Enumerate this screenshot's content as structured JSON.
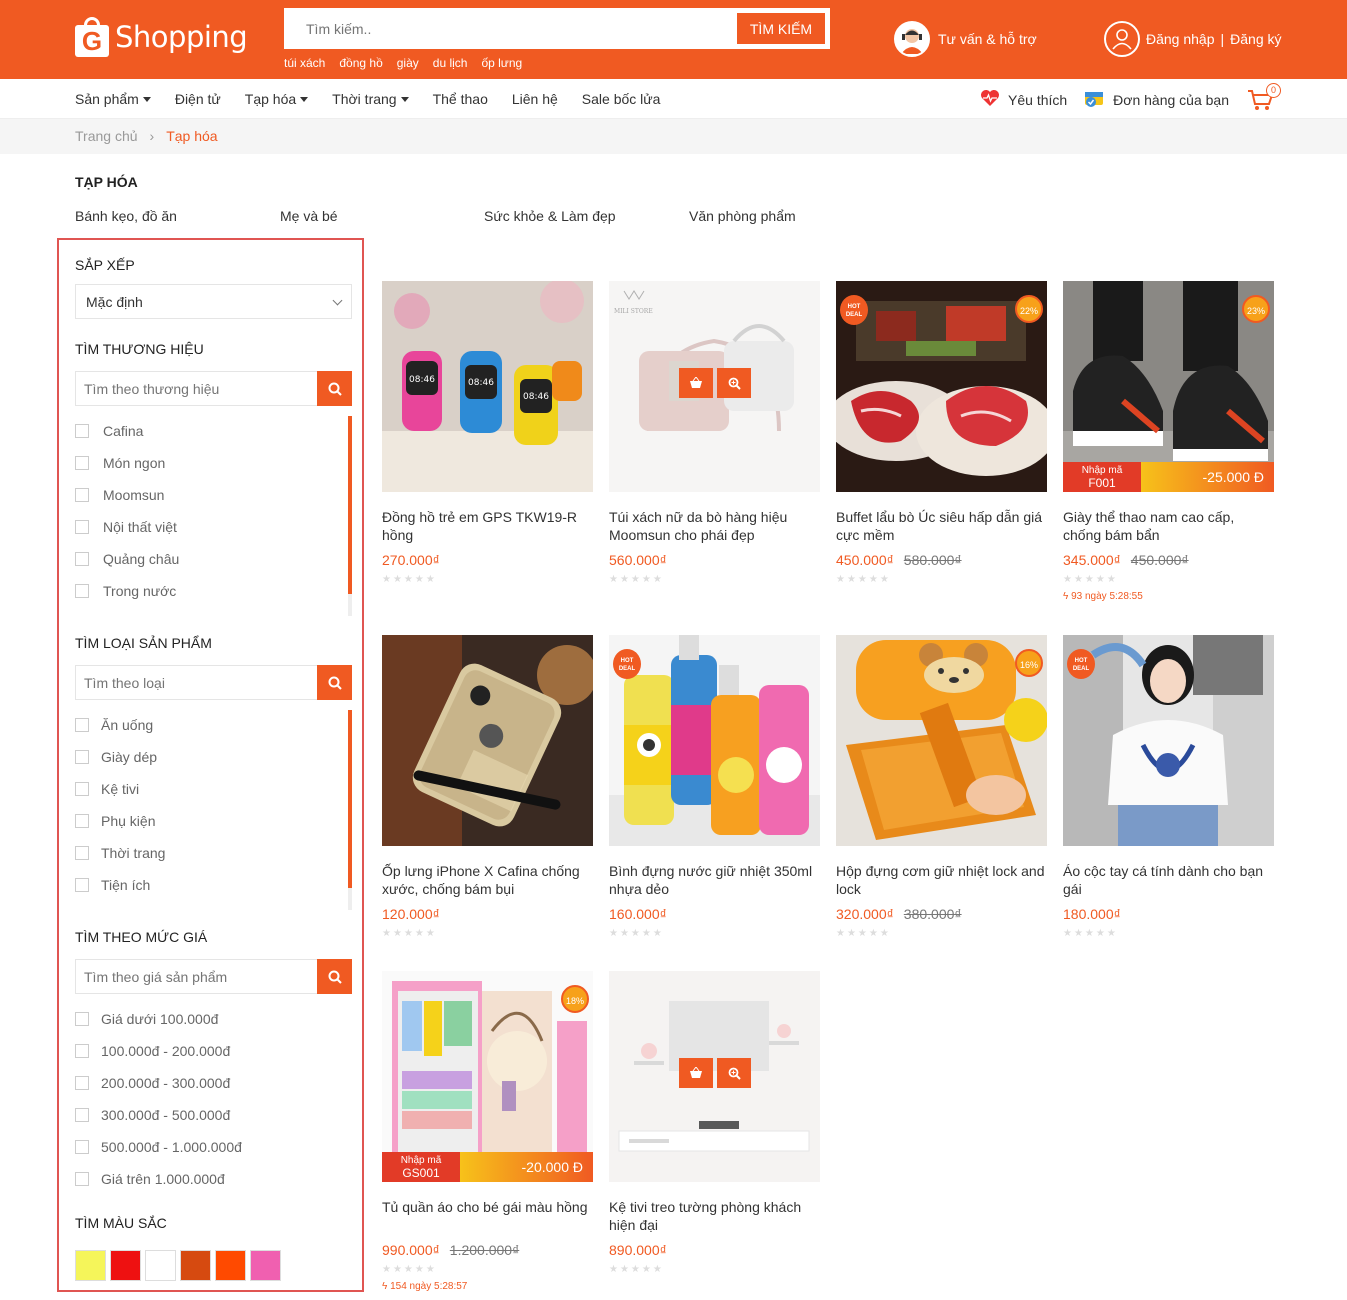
{
  "header": {
    "logo_letter": "G",
    "logo_text": "Shopping",
    "search_placeholder": "Tìm kiếm..",
    "search_button": "TÌM KIẾM",
    "hot_keywords": [
      "túi xách",
      "đồng hồ",
      "giày",
      "du lịch",
      "ốp lưng"
    ],
    "support_label": "Tư vấn & hỗ trợ",
    "login_label": "Đăng nhập",
    "register_label": "Đăng ký",
    "login_separator": "|"
  },
  "nav": {
    "items": [
      {
        "label": "Sản phẩm",
        "dropdown": true
      },
      {
        "label": "Điện tử",
        "dropdown": false
      },
      {
        "label": "Tạp hóa",
        "dropdown": true
      },
      {
        "label": "Thời trang",
        "dropdown": true
      },
      {
        "label": "Thể thao",
        "dropdown": false
      },
      {
        "label": "Liên hệ",
        "dropdown": false
      },
      {
        "label": "Sale bốc lửa",
        "dropdown": false
      }
    ],
    "wishlist": "Yêu thích",
    "orders": "Đơn hàng của bạn",
    "cart_count": "0"
  },
  "breadcrumb": {
    "home": "Trang chủ",
    "separator": "›",
    "current": "Tạp hóa"
  },
  "category": {
    "title": "TẠP HÓA",
    "subcategories": [
      "Bánh kẹo, đồ ăn",
      "Mẹ và bé",
      "Sức khỏe & Làm đẹp",
      "Văn phòng phẩm"
    ]
  },
  "sidebar": {
    "sort_title": "SẮP XẾP",
    "sort_value": "Mặc định",
    "brand_title": "TÌM THƯƠNG HIỆU",
    "brand_placeholder": "Tìm theo thương hiệu",
    "brands": [
      "Cafina",
      "Món ngon",
      "Moomsun",
      "Nội thất việt",
      "Quảng châu",
      "Trong nước"
    ],
    "type_title": "TÌM LOẠI SẢN PHẨM",
    "type_placeholder": "Tìm theo loại",
    "types": [
      "Ăn uống",
      "Giày dép",
      "Kệ tivi",
      "Phụ kiện",
      "Thời trang",
      "Tiện ích"
    ],
    "price_title": "TÌM THEO MỨC GIÁ",
    "price_placeholder": "Tìm theo giá sản phẩm",
    "prices": [
      "Giá dưới 100.000đ",
      "100.000đ - 200.000đ",
      "200.000đ - 300.000đ",
      "300.000đ - 500.000đ",
      "500.000đ - 1.000.000đ",
      "Giá trên 1.000.000đ"
    ],
    "color_title": "TÌM MÀU SẮC",
    "colors": [
      "#f5f55a",
      "#ee1111",
      "#ffffff",
      "#d64a10",
      "#ff4a00",
      "#f060b0"
    ]
  },
  "products": [
    {
      "name": "Đồng hồ trẻ em GPS TKW19-R hồng",
      "price": "270.000₫",
      "old_price": "",
      "badge": "",
      "hot": false,
      "promo_code": "",
      "promo_amount": "",
      "timer": "",
      "img": "watch"
    },
    {
      "name": "Túi xách nữ da bò hàng hiệu Moomsun cho phái đẹp",
      "price": "560.000₫",
      "old_price": "",
      "badge": "",
      "hot": false,
      "promo_code": "",
      "promo_amount": "",
      "timer": "",
      "img": "bag",
      "hover": true,
      "brand_mark": "MILI STORE"
    },
    {
      "name": "Buffet lẩu bò Úc siêu hấp dẫn giá cực mềm",
      "price": "450.000₫",
      "old_price": "580.000₫",
      "badge": "22%",
      "hot": true,
      "promo_code": "",
      "promo_amount": "",
      "timer": "",
      "img": "beef"
    },
    {
      "name": "Giày thể thao nam cao cấp, chống bám bẩn",
      "price": "345.000₫",
      "old_price": "450.000₫",
      "badge": "23%",
      "hot": false,
      "promo_code": "F001",
      "promo_amount": "-25.000 Đ",
      "timer": "93 ngày 5:28:55",
      "img": "shoe"
    },
    {
      "name": "Ốp lưng iPhone X Cafina chống xước, chống bám bụi",
      "price": "120.000₫",
      "old_price": "",
      "badge": "",
      "hot": false,
      "promo_code": "",
      "promo_amount": "",
      "timer": "",
      "img": "phone"
    },
    {
      "name": "Bình đựng nước giữ nhiệt 350ml nhựa dẻo",
      "price": "160.000₫",
      "old_price": "",
      "badge": "",
      "hot": true,
      "promo_code": "",
      "promo_amount": "",
      "timer": "",
      "img": "bottle"
    },
    {
      "name": "Hộp đựng cơm giữ nhiệt lock and lock",
      "price": "320.000₫",
      "old_price": "380.000₫",
      "badge": "16%",
      "hot": false,
      "promo_code": "",
      "promo_amount": "",
      "timer": "",
      "img": "lunch"
    },
    {
      "name": "Áo cộc tay cá tính dành cho bạn gái",
      "price": "180.000₫",
      "old_price": "",
      "badge": "",
      "hot": true,
      "promo_code": "",
      "promo_amount": "",
      "timer": "",
      "img": "girl"
    },
    {
      "name": "Tủ quần áo cho bé gái màu hồng",
      "price": "990.000₫",
      "old_price": "1.200.000₫",
      "badge": "18%",
      "hot": false,
      "promo_code": "GS001",
      "promo_amount": "-20.000 Đ",
      "timer": "154 ngày 5:28:57",
      "img": "wardrobe"
    },
    {
      "name": "Kệ tivi treo tường phòng khách hiện đại",
      "price": "890.000₫",
      "old_price": "",
      "badge": "",
      "hot": false,
      "promo_code": "",
      "promo_amount": "",
      "timer": "",
      "img": "tv",
      "hover": true
    }
  ],
  "labels": {
    "hot_deal": "HOT DEAL",
    "promo_prefix": "Nhập mã",
    "stars": "★★★★★"
  },
  "colors": {
    "brand": "#f05a22",
    "sidebar_border": "#e05552"
  }
}
